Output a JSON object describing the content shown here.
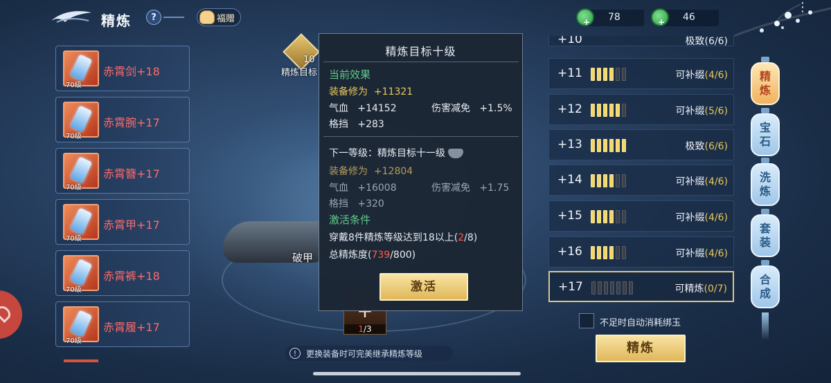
{
  "header": {
    "title": "精炼",
    "help_label": "?",
    "gift_label": "福赠",
    "currency": [
      {
        "icon": "jade-green-icon",
        "value": "78"
      },
      {
        "icon": "jade-ring-icon",
        "value": "46"
      }
    ],
    "more_label": "⋮"
  },
  "equipment": [
    {
      "name": "赤霄剑+18",
      "level": "70级"
    },
    {
      "name": "赤霄腕+17",
      "level": "70级"
    },
    {
      "name": "赤霄簪+17",
      "level": "70级"
    },
    {
      "name": "赤霄甲+17",
      "level": "70级"
    },
    {
      "name": "赤霄裤+18",
      "level": "70级"
    },
    {
      "name": "赤霄履+17",
      "level": "70级"
    }
  ],
  "center": {
    "target_badge_num": "10",
    "target_badge_label": "精炼目标",
    "pojia_label": "破甲",
    "gem_slot_plus": "+",
    "gem_slot_count_current": "1",
    "gem_slot_count_total": "/3",
    "hint_icon": "!",
    "hint_text": "更换装备时可完美继承精炼等级"
  },
  "popup": {
    "title": "精炼目标十级",
    "current_header": "当前效果",
    "current_cult_label": "装备修为",
    "current_cult_value": "+11321",
    "current_hp_label": "气血",
    "current_hp_value": "+14152",
    "current_dr_label": "伤害减免",
    "current_dr_value": "+1.5%",
    "current_block_label": "格挡",
    "current_block_value": "+283",
    "next_header": "下一等级：精炼目标十一级",
    "next_cult_label": "装备修为",
    "next_cult_value": "+12804",
    "next_hp_label": "气血",
    "next_hp_value": "+16008",
    "next_dr_label": "伤害减免",
    "next_dr_value": "+1.75",
    "next_block_label": "格挡",
    "next_block_value": "+320",
    "activate_header": "激活条件",
    "cond1_prefix": "穿戴8件精炼等级达到18以上(",
    "cond1_current": "2",
    "cond1_suffix": "/8)",
    "cond2_prefix": "总精炼度(",
    "cond2_current": "739",
    "cond2_suffix": "/800)",
    "activate_button": "激活"
  },
  "refine": {
    "partial_level": "+10",
    "partial_status": "极致(6/6)",
    "rows": [
      {
        "level": "+11",
        "filled": 4,
        "total": 6,
        "status": "可补缀",
        "count": "(4/6)",
        "selected": false
      },
      {
        "level": "+12",
        "filled": 5,
        "total": 6,
        "status": "可补缀",
        "count": "(5/6)",
        "selected": false
      },
      {
        "level": "+13",
        "filled": 6,
        "total": 6,
        "status": "极致",
        "count": "(6/6)",
        "selected": false
      },
      {
        "level": "+14",
        "filled": 4,
        "total": 6,
        "status": "可补缀",
        "count": "(4/6)",
        "selected": false
      },
      {
        "level": "+15",
        "filled": 4,
        "total": 6,
        "status": "可补缀",
        "count": "(4/6)",
        "selected": false
      },
      {
        "level": "+16",
        "filled": 4,
        "total": 6,
        "status": "可补缀",
        "count": "(4/6)",
        "selected": false
      },
      {
        "level": "+17",
        "filled": 0,
        "total": 7,
        "status": "可精炼",
        "count": "(0/7)",
        "selected": true
      }
    ],
    "auto_consume_label": "不足时自动消耗绑玉",
    "refine_button": "精炼"
  },
  "tabs": [
    {
      "top": "精",
      "bottom": "炼",
      "active": true
    },
    {
      "top": "宝",
      "bottom": "石",
      "active": false
    },
    {
      "top": "洗",
      "bottom": "炼",
      "active": false
    },
    {
      "top": "套",
      "bottom": "装",
      "active": false
    },
    {
      "top": "合",
      "bottom": "成",
      "active": false
    }
  ],
  "colors": {
    "accent_gold": "#e7c85a",
    "equipment_name_red": "#ff6a6a",
    "current_effect_green": "#5fc98b",
    "warning_red": "#ff5b4e"
  }
}
